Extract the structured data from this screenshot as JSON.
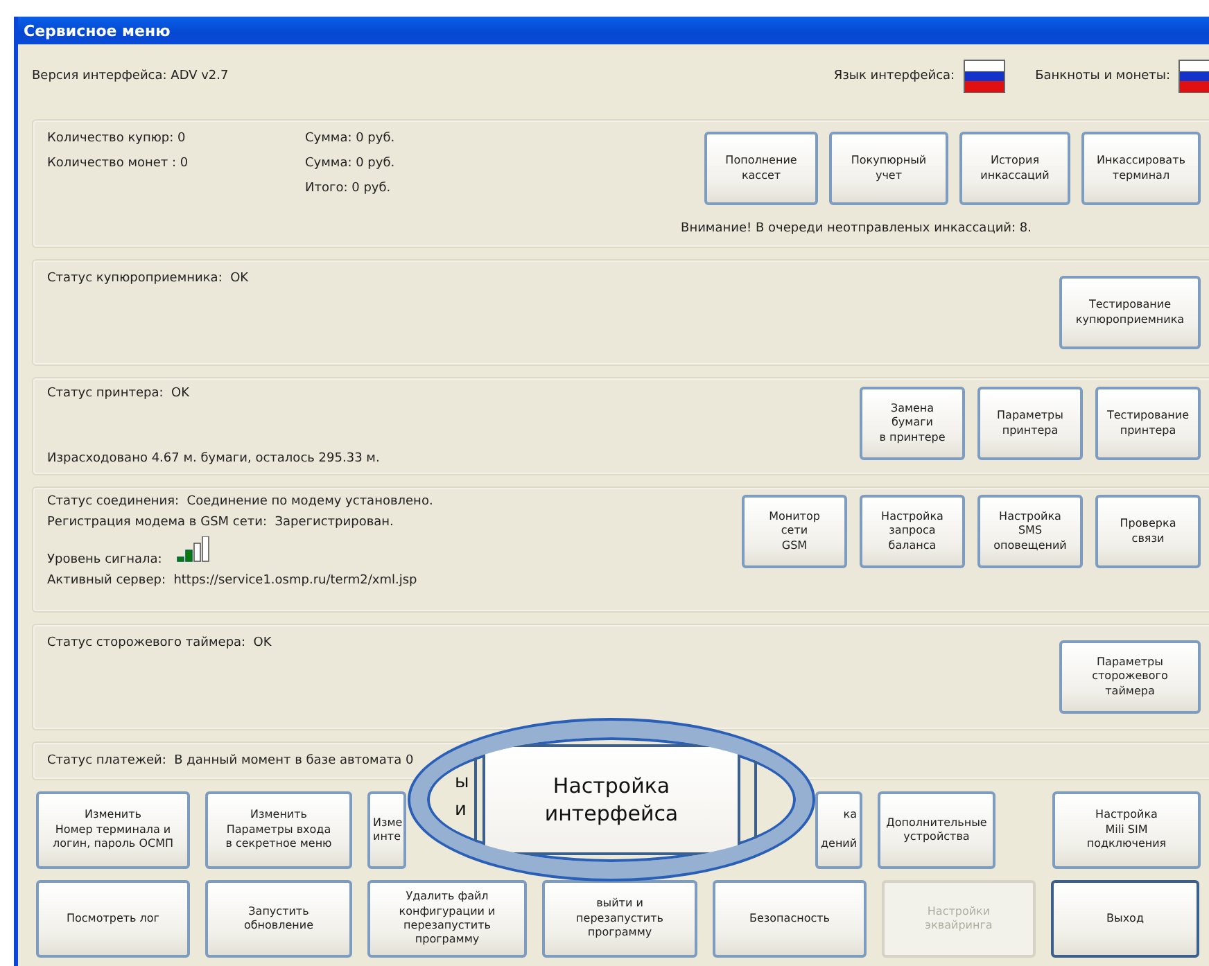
{
  "window": {
    "title": "Сервисное меню"
  },
  "header": {
    "version": "Версия интерфейса: ADV v2.7",
    "language_label": "Язык интерфейса:",
    "currency_label": "Банкноты и монеты:"
  },
  "sections": [
    {
      "kind": "cash",
      "counts": [
        "Количество купюр: 0",
        "Количество монет : 0"
      ],
      "sums": [
        "Сумма: 0 руб.",
        "Сумма: 0 руб.",
        "Итого: 0 руб."
      ],
      "notice": "Внимание! В очереди неотправленых инкассаций: 8.",
      "buttons": [
        "Пополнение\nкассет",
        "Покупюрный\nучет",
        "История\nинкассаций",
        "Инкассировать\nтерминал"
      ]
    },
    {
      "kind": "status",
      "top": [
        "Статус купюроприемника:  OK"
      ],
      "buttons": [
        "Тестирование\nкупюроприемника"
      ]
    },
    {
      "kind": "status",
      "top": [
        "Статус принтера:  OK"
      ],
      "bottom": [
        "Израсходовано 4.67 м. бумаги, осталось 295.33 м."
      ],
      "buttons": [
        "Замена\nбумаги\nв принтере",
        "Параметры\nпринтера",
        "Тестирование\nпринтера"
      ]
    },
    {
      "kind": "connection",
      "status": "Статус соединения:  Соединение по модему установлено.",
      "registration": "Регистрация модема в GSM сети:  Зарегистрирован.",
      "signal_label": "Уровень сигнала:",
      "server": "Активный сервер:  https://service1.osmp.ru/term2/xml.jsp",
      "buttons": [
        "Монитор\nсети\nGSM",
        "Настройка\nзапроса\nбаланса",
        "Настройка\nSMS\nоповещений",
        "Проверка\nсвязи"
      ]
    },
    {
      "kind": "status",
      "top": [
        "Статус сторожевого таймера:  OK"
      ],
      "buttons": [
        "Параметры\nсторожевого\nтаймера"
      ]
    }
  ],
  "payments": "Статус платежей:  В данный момент в базе автомата 0",
  "button_rows": [
    [
      {
        "kind": "button",
        "label": "Изменить\nНомер терминала и\nлогин, пароль ОСМП",
        "disabled": false,
        "default": false
      },
      {
        "kind": "button",
        "label": "Изменить\nПараметры входа\nв секретное меню",
        "disabled": false,
        "default": false
      },
      {
        "kind": "left_part",
        "label": "Изме\nинте",
        "disabled": false,
        "default": false
      },
      {
        "kind": "right_part",
        "label": "ка\n\nдений",
        "disabled": false,
        "default": false
      },
      {
        "kind": "button",
        "label": "Дополнительные\nустройства",
        "disabled": false,
        "default": false
      },
      {
        "kind": "button",
        "label": "Настройка\nMili SIM\nподключения",
        "disabled": false,
        "default": false
      }
    ],
    [
      {
        "kind": "button",
        "label": "Посмотреть лог",
        "disabled": false,
        "default": false
      },
      {
        "kind": "button",
        "label": "Запустить\nобновление",
        "disabled": false,
        "default": false
      },
      {
        "kind": "button",
        "label": "Удалить файл\nконфигурации и\nперезапустить\nпрограмму",
        "disabled": false,
        "default": false
      },
      {
        "kind": "button",
        "label": "выйти и\nперезапустить\nпрограмму",
        "disabled": false,
        "default": false
      },
      {
        "kind": "button",
        "label": "Безопасность",
        "disabled": false,
        "default": false
      },
      {
        "kind": "button",
        "label": "Настройки\nэквайринга",
        "disabled": true,
        "default": false
      },
      {
        "kind": "button",
        "label": "Выход",
        "disabled": false,
        "default": true
      }
    ]
  ],
  "magnifier": {
    "label": "Настройка\nинтерфейса",
    "fragments": [
      "ы",
      "и"
    ]
  }
}
